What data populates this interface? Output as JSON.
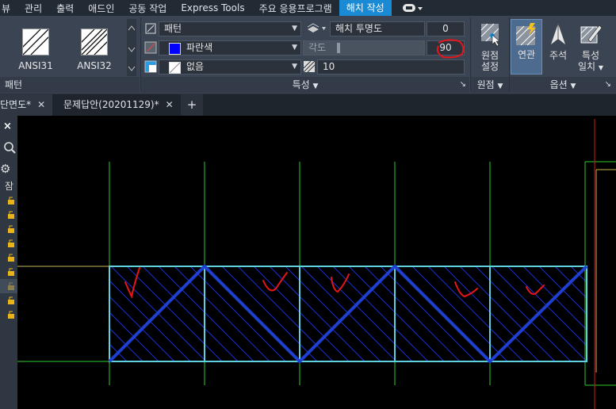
{
  "menu": [
    "뷰",
    "관리",
    "출력",
    "애드인",
    "공동 작업",
    "Express Tools",
    "주요 응용프로그램",
    "해치 작성"
  ],
  "menu_active_index": 7,
  "pattern_panel": {
    "swatches": [
      "ANSI31",
      "ANSI32"
    ],
    "footer": "패턴"
  },
  "properties_panel": {
    "pattern_type": "패턴",
    "color": "파란색",
    "color_hex": "#0000ff",
    "background": "없음",
    "transparency_label": "해치 투명도",
    "transparency_value": "0",
    "angle_label": "각도",
    "angle_value": "90",
    "scale_value": "10",
    "footer": "특성"
  },
  "origin_panel": {
    "button": "원점\n설정",
    "footer": "원점"
  },
  "options_panel": {
    "associative": "연관",
    "annotative": "주석",
    "match_properties": "특성\n일치",
    "footer": "옵션"
  },
  "tabs": [
    {
      "label": "단면도*",
      "active": true
    },
    {
      "label": "문제답안(20201129)*",
      "active": false
    }
  ],
  "left_toolbar": {
    "close": "×",
    "label": "잠"
  },
  "colors": {
    "ribbon_bg": "#3b4453",
    "active_tab": "#1a8ad4",
    "hatch_blue": "#1e3fd0",
    "grid_green": "#2ecc2e",
    "annotation_red": "#e8141c"
  }
}
